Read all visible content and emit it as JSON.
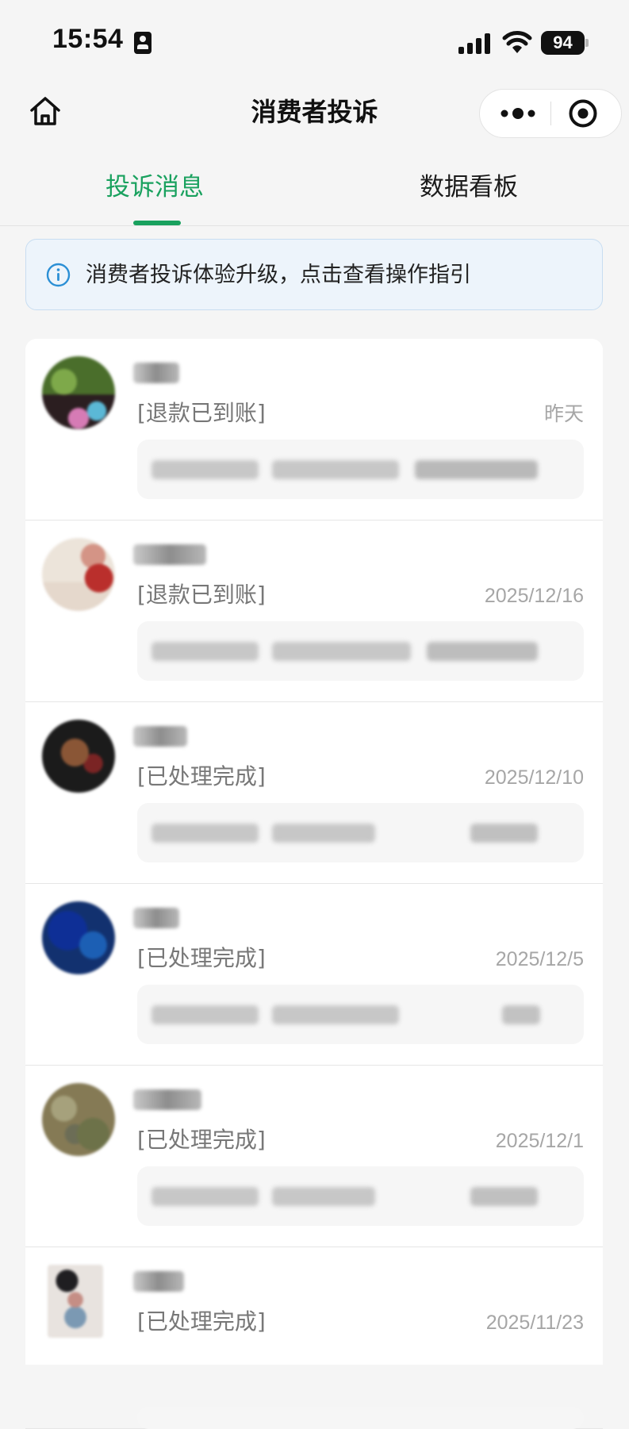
{
  "status_bar": {
    "time": "15:54",
    "battery": "94"
  },
  "nav": {
    "title": "消费者投诉"
  },
  "tabs": [
    {
      "label": "投诉消息",
      "active": true
    },
    {
      "label": "数据看板",
      "active": false
    }
  ],
  "notice": {
    "text": "消费者投诉体验升级，点击查看操作指引"
  },
  "complaints": [
    {
      "status": "[退款已到账]",
      "date": "昨天",
      "avatar_colors": [
        "#4a6e2b",
        "#7ea94a",
        "#d67bb5",
        "#5bb8d6"
      ]
    },
    {
      "status": "[退款已到账]",
      "date": "2025/12/16",
      "avatar_colors": [
        "#e5d8cc",
        "#d49486",
        "#ba2f2c",
        "#9a3c35"
      ]
    },
    {
      "status": "[已处理完成]",
      "date": "2025/12/10",
      "avatar_colors": [
        "#1b1b1b",
        "#8a5636",
        "#3a2019",
        "#7a2424"
      ]
    },
    {
      "status": "[已处理完成]",
      "date": "2025/12/5",
      "avatar_colors": [
        "#12316f",
        "#0e2f96",
        "#1c5fb4",
        "#0a2268"
      ]
    },
    {
      "status": "[已处理完成]",
      "date": "2025/12/1",
      "avatar_colors": [
        "#857a55",
        "#6d7249",
        "#a6a17c",
        "#6c6d56"
      ]
    },
    {
      "status": "[已处理完成]",
      "date": "2025/11/23",
      "avatar_colors": [
        "#e8e3df",
        "#1f1e21",
        "#c58e85",
        "#7b99b3"
      ]
    }
  ]
}
